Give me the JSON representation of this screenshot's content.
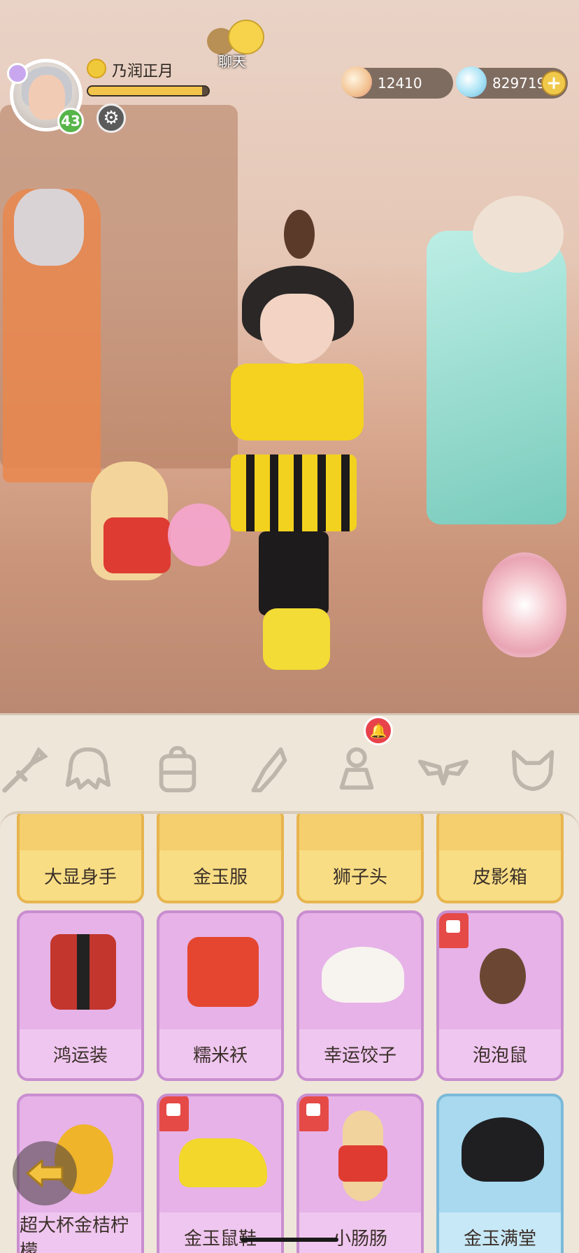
{
  "header": {
    "player_name": "乃润正月",
    "level": "43",
    "xp_fraction": 0.95,
    "chat_label": "聊天",
    "currency": [
      {
        "icon": "shell-icon",
        "value": "12410"
      },
      {
        "icon": "crystal-icon",
        "value": "829719"
      }
    ],
    "add_label": "+"
  },
  "tabs": [
    {
      "icon": "sword-icon"
    },
    {
      "icon": "hair-icon"
    },
    {
      "icon": "backpack-icon"
    },
    {
      "icon": "feather-icon"
    },
    {
      "icon": "mannequin-icon"
    },
    {
      "icon": "wings-icon"
    },
    {
      "icon": "fox-mask-icon"
    }
  ],
  "tab_badge": "!",
  "items": {
    "row1": [
      "大显身手",
      "金玉服",
      "狮子头",
      "皮影箱"
    ],
    "row2": [
      "鸿运装",
      "糯米袄",
      "幸运饺子",
      "泡泡鼠"
    ],
    "row3": [
      "超大杯金桔柠檬",
      "金玉鼠鞋",
      "小肠肠",
      "金玉满堂"
    ]
  },
  "colors": {
    "gold_card": "#f5cf6d",
    "purple_card": "#e6b2e8",
    "blue_card": "#a8d9ef",
    "badge_red": "#e54a47"
  }
}
